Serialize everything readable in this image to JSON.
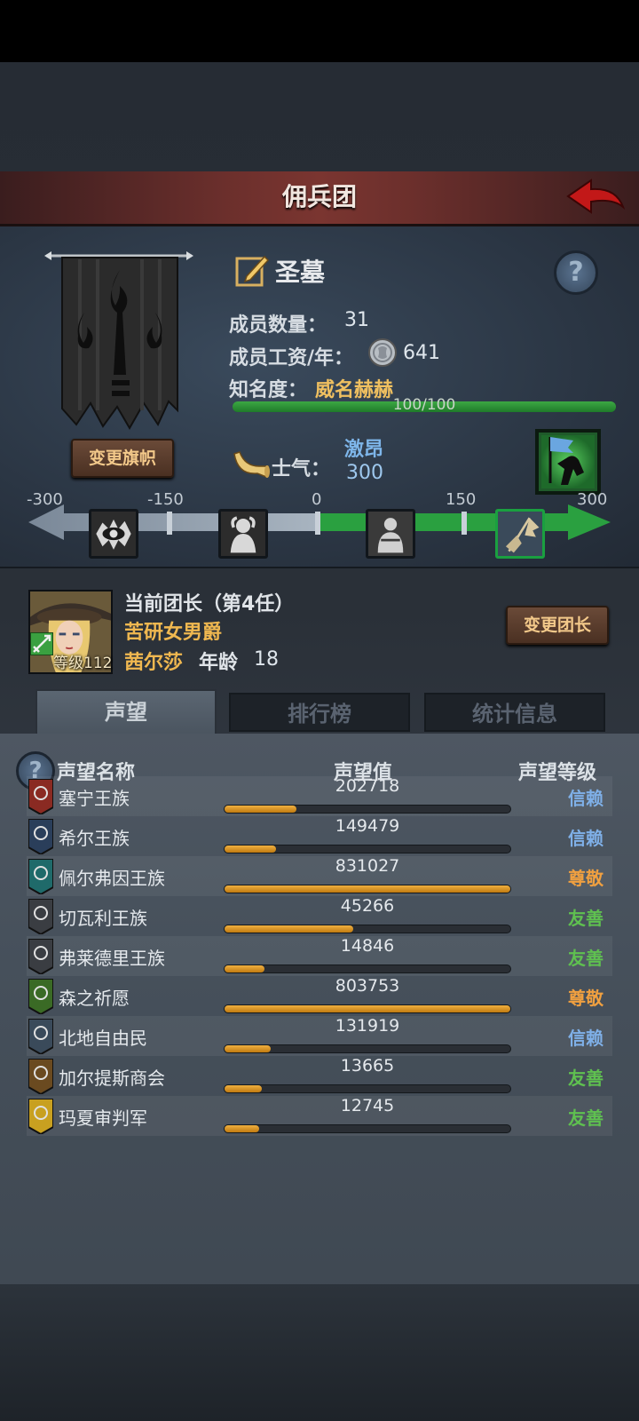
{
  "header": {
    "title": "佣兵团"
  },
  "guild": {
    "name": "圣墓",
    "member_count_label": "成员数量：",
    "member_count": "31",
    "salary_label": "成员工资/年：",
    "salary": "641",
    "fame_label": "知名度：",
    "fame_value": "威名赫赫",
    "fame_progress_text": "100/100",
    "fame_progress": 1.0,
    "change_flag_label": "变更旗帜"
  },
  "morale": {
    "label": "士气：",
    "state": "激昂",
    "value": "300",
    "scale_ticks": [
      "-300",
      "-150",
      "0",
      "150",
      "300"
    ],
    "level_icons": [
      "eye-icon",
      "despair-icon",
      "calm-icon",
      "banner-icon"
    ]
  },
  "captain": {
    "title": "当前团长（第4任）",
    "class": "苦研女男爵",
    "name": "茜尔莎",
    "age_label": "年龄",
    "age": "18",
    "level_text": "等级112",
    "change_leader_label": "变更团长"
  },
  "tabs": [
    {
      "label": "声望",
      "active": true
    },
    {
      "label": "排行榜",
      "active": false
    },
    {
      "label": "统计信息",
      "active": false
    }
  ],
  "reputation": {
    "headers": {
      "name": "声望名称",
      "value": "声望值",
      "level": "声望等级"
    },
    "rows": [
      {
        "name": "塞宁王族",
        "value": "202718",
        "level": "信赖",
        "level_color": "#7fb0e8",
        "progress": 0.25,
        "emblem_color": "#8a2a22"
      },
      {
        "name": "希尔王族",
        "value": "149479",
        "level": "信赖",
        "level_color": "#7fb0e8",
        "progress": 0.18,
        "emblem_color": "#2a3e5a"
      },
      {
        "name": "佩尔弗因王族",
        "value": "831027",
        "level": "尊敬",
        "level_color": "#f0a040",
        "progress": 1.0,
        "emblem_color": "#1f6a6a"
      },
      {
        "name": "切瓦利王族",
        "value": "45266",
        "level": "友善",
        "level_color": "#5fc050",
        "progress": 0.45,
        "emblem_color": "#3a3d42"
      },
      {
        "name": "弗莱德里王族",
        "value": "14846",
        "level": "友善",
        "level_color": "#5fc050",
        "progress": 0.14,
        "emblem_color": "#3a3d42"
      },
      {
        "name": "森之祈愿",
        "value": "803753",
        "level": "尊敬",
        "level_color": "#f0a040",
        "progress": 1.0,
        "emblem_color": "#3a6a25"
      },
      {
        "name": "北地自由民",
        "value": "131919",
        "level": "信赖",
        "level_color": "#7fb0e8",
        "progress": 0.16,
        "emblem_color": "#3a4a5a"
      },
      {
        "name": "加尔提斯商会",
        "value": "13665",
        "level": "友善",
        "level_color": "#5fc050",
        "progress": 0.13,
        "emblem_color": "#6a4a20"
      },
      {
        "name": "玛夏审判军",
        "value": "12745",
        "level": "友善",
        "level_color": "#5fc050",
        "progress": 0.12,
        "emblem_color": "#c8a020"
      }
    ]
  }
}
